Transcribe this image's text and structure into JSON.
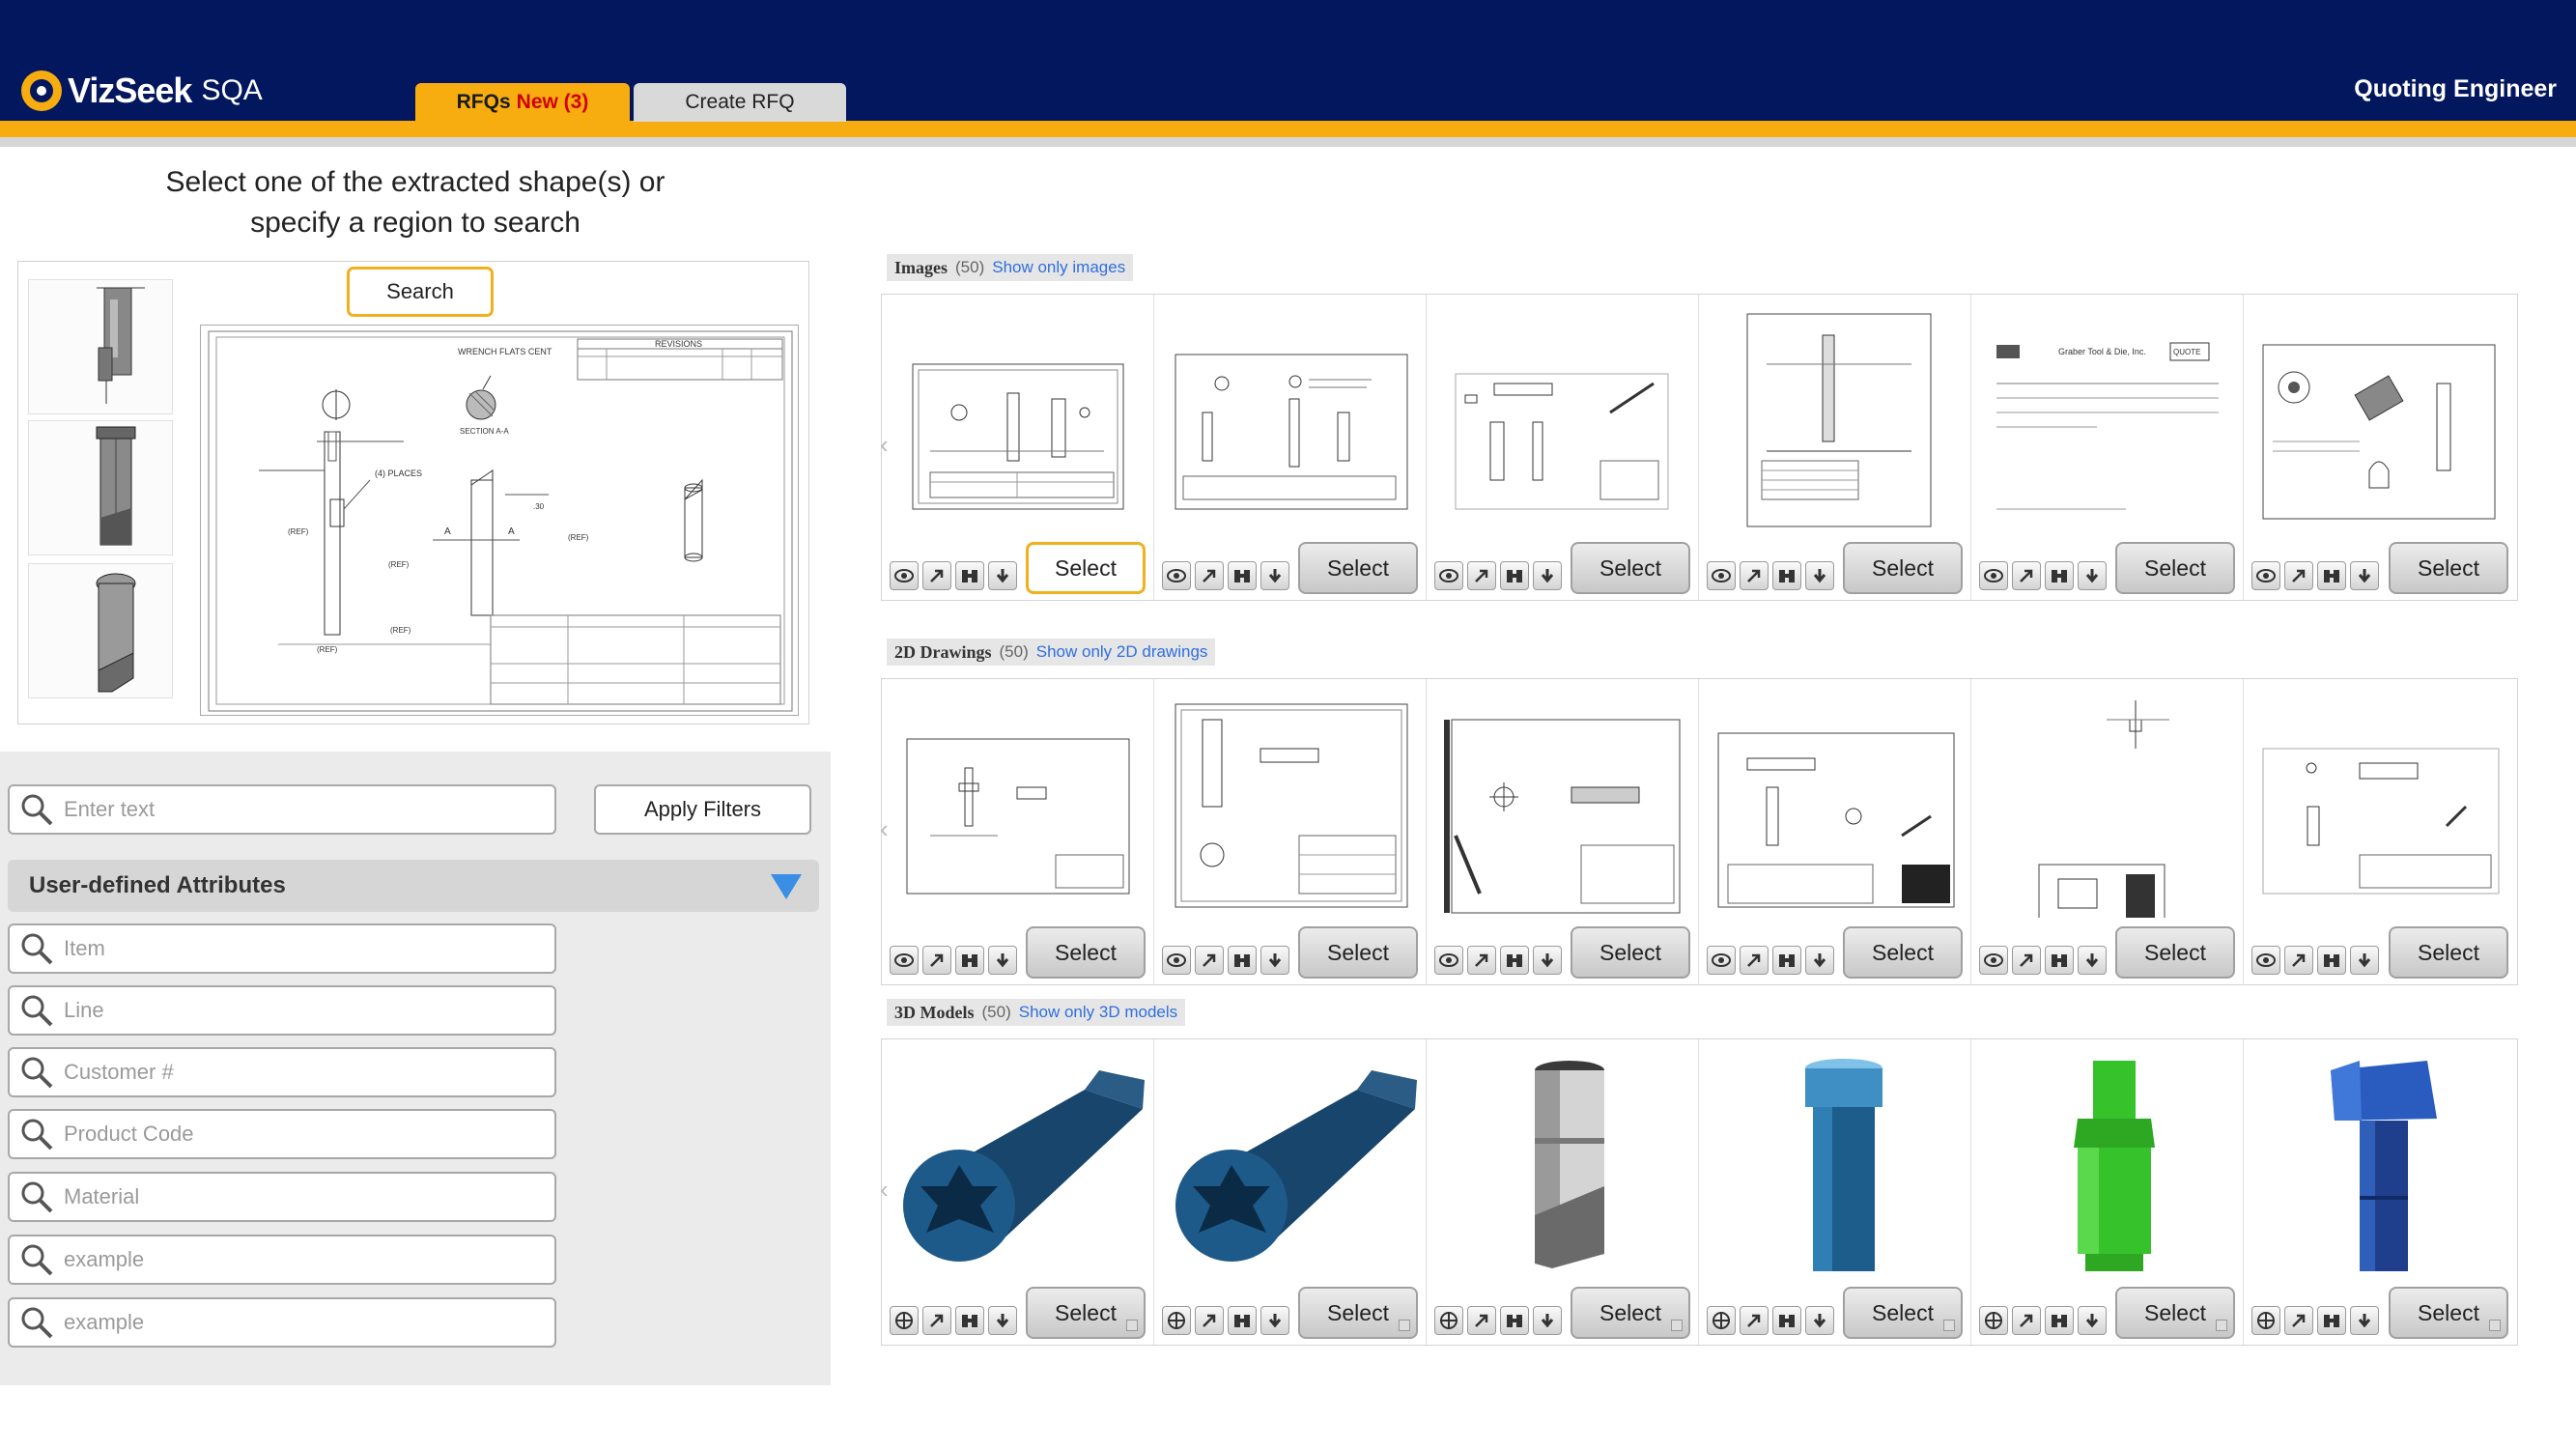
{
  "header": {
    "brand_bold": "VizSeek",
    "brand_sub": "SQA",
    "tabs": [
      {
        "label": "RFQs",
        "badge": "New (3)"
      },
      {
        "label": "Create RFQ"
      }
    ],
    "role": "Quoting Engineer",
    "colors": {
      "navy": "#03175f",
      "accent": "#f7ad10",
      "alert": "#d10000"
    }
  },
  "left": {
    "instructions_line1": "Select one of the extracted shape(s) or",
    "instructions_line2": "specify a region to search",
    "search_button": "Search",
    "drawing_texts": {
      "revisions": "REVISIONS",
      "wrench_flats": "WRENCH FLATS CENT",
      "section": "SECTION A-A",
      "places": "(4) PLACES",
      "ref": "(REF)",
      "a": "A",
      "dim": ".30"
    },
    "shapes": [
      {
        "selected": false
      },
      {
        "selected": true
      },
      {
        "selected": true
      }
    ],
    "search_placeholder": "Enter text",
    "apply_button": "Apply Filters",
    "uda_title": "User-defined Attributes",
    "attributes": [
      "Item",
      "Line",
      "Customer #",
      "Product Code",
      "Material",
      "example",
      "example"
    ]
  },
  "results": {
    "select_label": "Select",
    "sections": [
      {
        "title": "Images",
        "count": "(50)",
        "link": "Show only images"
      },
      {
        "title": "2D Drawings",
        "count": "(50)",
        "link": "Show only 2D drawings"
      },
      {
        "title": "3D Models",
        "count": "(50)",
        "link": "Show only 3D models"
      }
    ],
    "image_doc_texts": {
      "company": "Graber Tool & Die, Inc.",
      "quote": "QUOTE"
    },
    "model_colors": [
      "#17456b",
      "#17456b",
      "#8a8a8a",
      "#1c5d8c",
      "#36c22a",
      "#1f4fa8"
    ],
    "icons": [
      "eye-icon",
      "arrow-icon",
      "binoculars-icon",
      "download-icon",
      "move-icon"
    ]
  }
}
